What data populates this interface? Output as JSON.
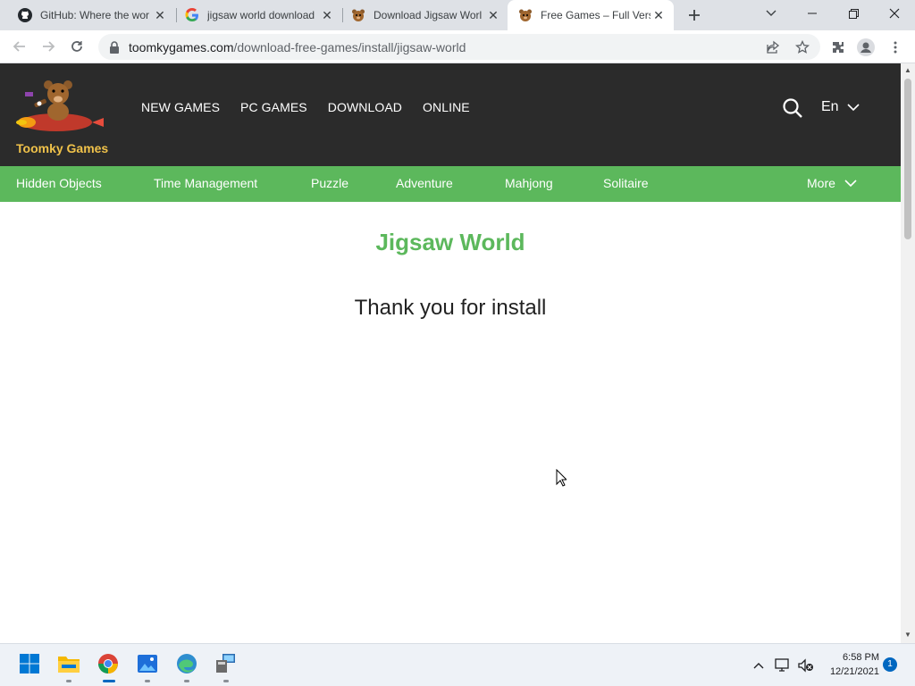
{
  "browser": {
    "tabs": [
      {
        "title": "GitHub: Where the wor",
        "icon": "github-icon"
      },
      {
        "title": "jigsaw world download",
        "icon": "google-icon"
      },
      {
        "title": "Download Jigsaw Worl",
        "icon": "bear-icon"
      },
      {
        "title": "Free Games – Full Vers",
        "icon": "bear-icon",
        "active": true
      }
    ],
    "address": {
      "domain": "toomkygames.com",
      "path": "/download-free-games/install/jigsaw-world"
    }
  },
  "site": {
    "logo_text": "Toomky Games",
    "main_nav": [
      "NEW GAMES",
      "PC GAMES",
      "DOWNLOAD",
      "ONLINE"
    ],
    "language": "En",
    "categories": [
      "Hidden Objects",
      "Time Management",
      "Puzzle",
      "Adventure",
      "Mahjong",
      "Solitaire"
    ],
    "more_label": "More",
    "colors": {
      "header": "#2b2b2b",
      "category_bar": "#5cb85c",
      "title": "#5cb85c",
      "logo_text": "#f0c24a"
    }
  },
  "content": {
    "title": "Jigsaw World",
    "message": "Thank you for install"
  },
  "taskbar": {
    "apps": [
      "windows-start-icon",
      "file-explorer-icon",
      "chrome-icon",
      "photos-icon",
      "edge-icon",
      "network-app-icon"
    ],
    "time": "6:58 PM",
    "date": "12/21/2021",
    "notifications": "1"
  }
}
